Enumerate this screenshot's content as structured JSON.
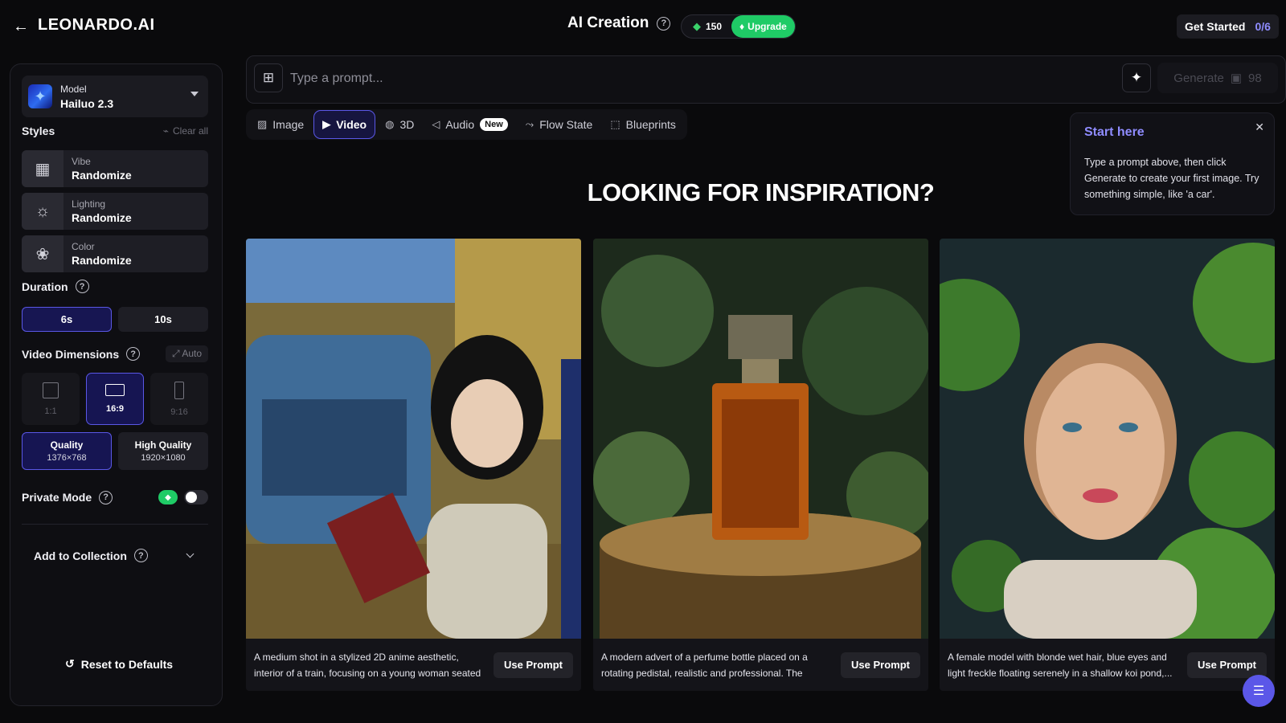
{
  "header": {
    "back_icon": "arrow-left-icon",
    "logo": "LEONARDO.AI",
    "title": "AI Creation",
    "token_count": "150",
    "upgrade_label": "Upgrade",
    "get_started_label": "Get Started",
    "get_started_count": "0/6"
  },
  "sidebar": {
    "model_label": "Model",
    "model_value": "Hailuo 2.3",
    "styles_title": "Styles",
    "clear_all": "Clear all",
    "styles": [
      {
        "key": "Vibe",
        "value": "Randomize",
        "icon": "vibe-icon"
      },
      {
        "key": "Lighting",
        "value": "Randomize",
        "icon": "lightbulb-icon"
      },
      {
        "key": "Color",
        "value": "Randomize",
        "icon": "color-circles-icon"
      }
    ],
    "duration_title": "Duration",
    "durations": [
      "6s",
      "10s"
    ],
    "dimensions_title": "Video Dimensions",
    "auto_label": "Auto",
    "ratios": [
      "1:1",
      "16:9",
      "9:16"
    ],
    "qualities": [
      {
        "label": "Quality",
        "res": "1376×768"
      },
      {
        "label": "High Quality",
        "res": "1920×1080"
      }
    ],
    "private_mode": "Private Mode",
    "add_collection": "Add to Collection",
    "reset": "Reset to Defaults"
  },
  "prompt": {
    "placeholder": "Type a prompt...",
    "generate_label": "Generate",
    "generate_cost": "98"
  },
  "tabs": [
    {
      "label": "Image",
      "icon": "image-icon"
    },
    {
      "label": "Video",
      "icon": "video-icon"
    },
    {
      "label": "3D",
      "icon": "3d-icon"
    },
    {
      "label": "Audio",
      "icon": "speaker-icon"
    },
    {
      "label": "Flow State",
      "icon": "flow-icon"
    },
    {
      "label": "Blueprints",
      "icon": "blueprint-icon"
    }
  ],
  "new_badge": "New",
  "tooltip": {
    "title": "Start here",
    "body": "Type a prompt above, then click Generate to create your first image. Try something simple, like 'a car'."
  },
  "main": {
    "heading": "LOOKING FOR INSPIRATION?",
    "cards": [
      {
        "text": "A medium shot in a stylized 2D anime aesthetic, interior of a train, focusing on a young woman seated ...",
        "button": "Use Prompt"
      },
      {
        "text": "A modern advert of a perfume bottle placed on a rotating pedistal, realistic and professional. The scen...",
        "button": "Use Prompt"
      },
      {
        "text": "A female model with blonde wet hair, blue eyes and light freckle floating serenely in a shallow koi pond,...",
        "button": "Use Prompt"
      }
    ]
  },
  "colors": {
    "accent": "#5a57e6",
    "green": "#1fcb66",
    "bg": "#0a0a0c"
  }
}
